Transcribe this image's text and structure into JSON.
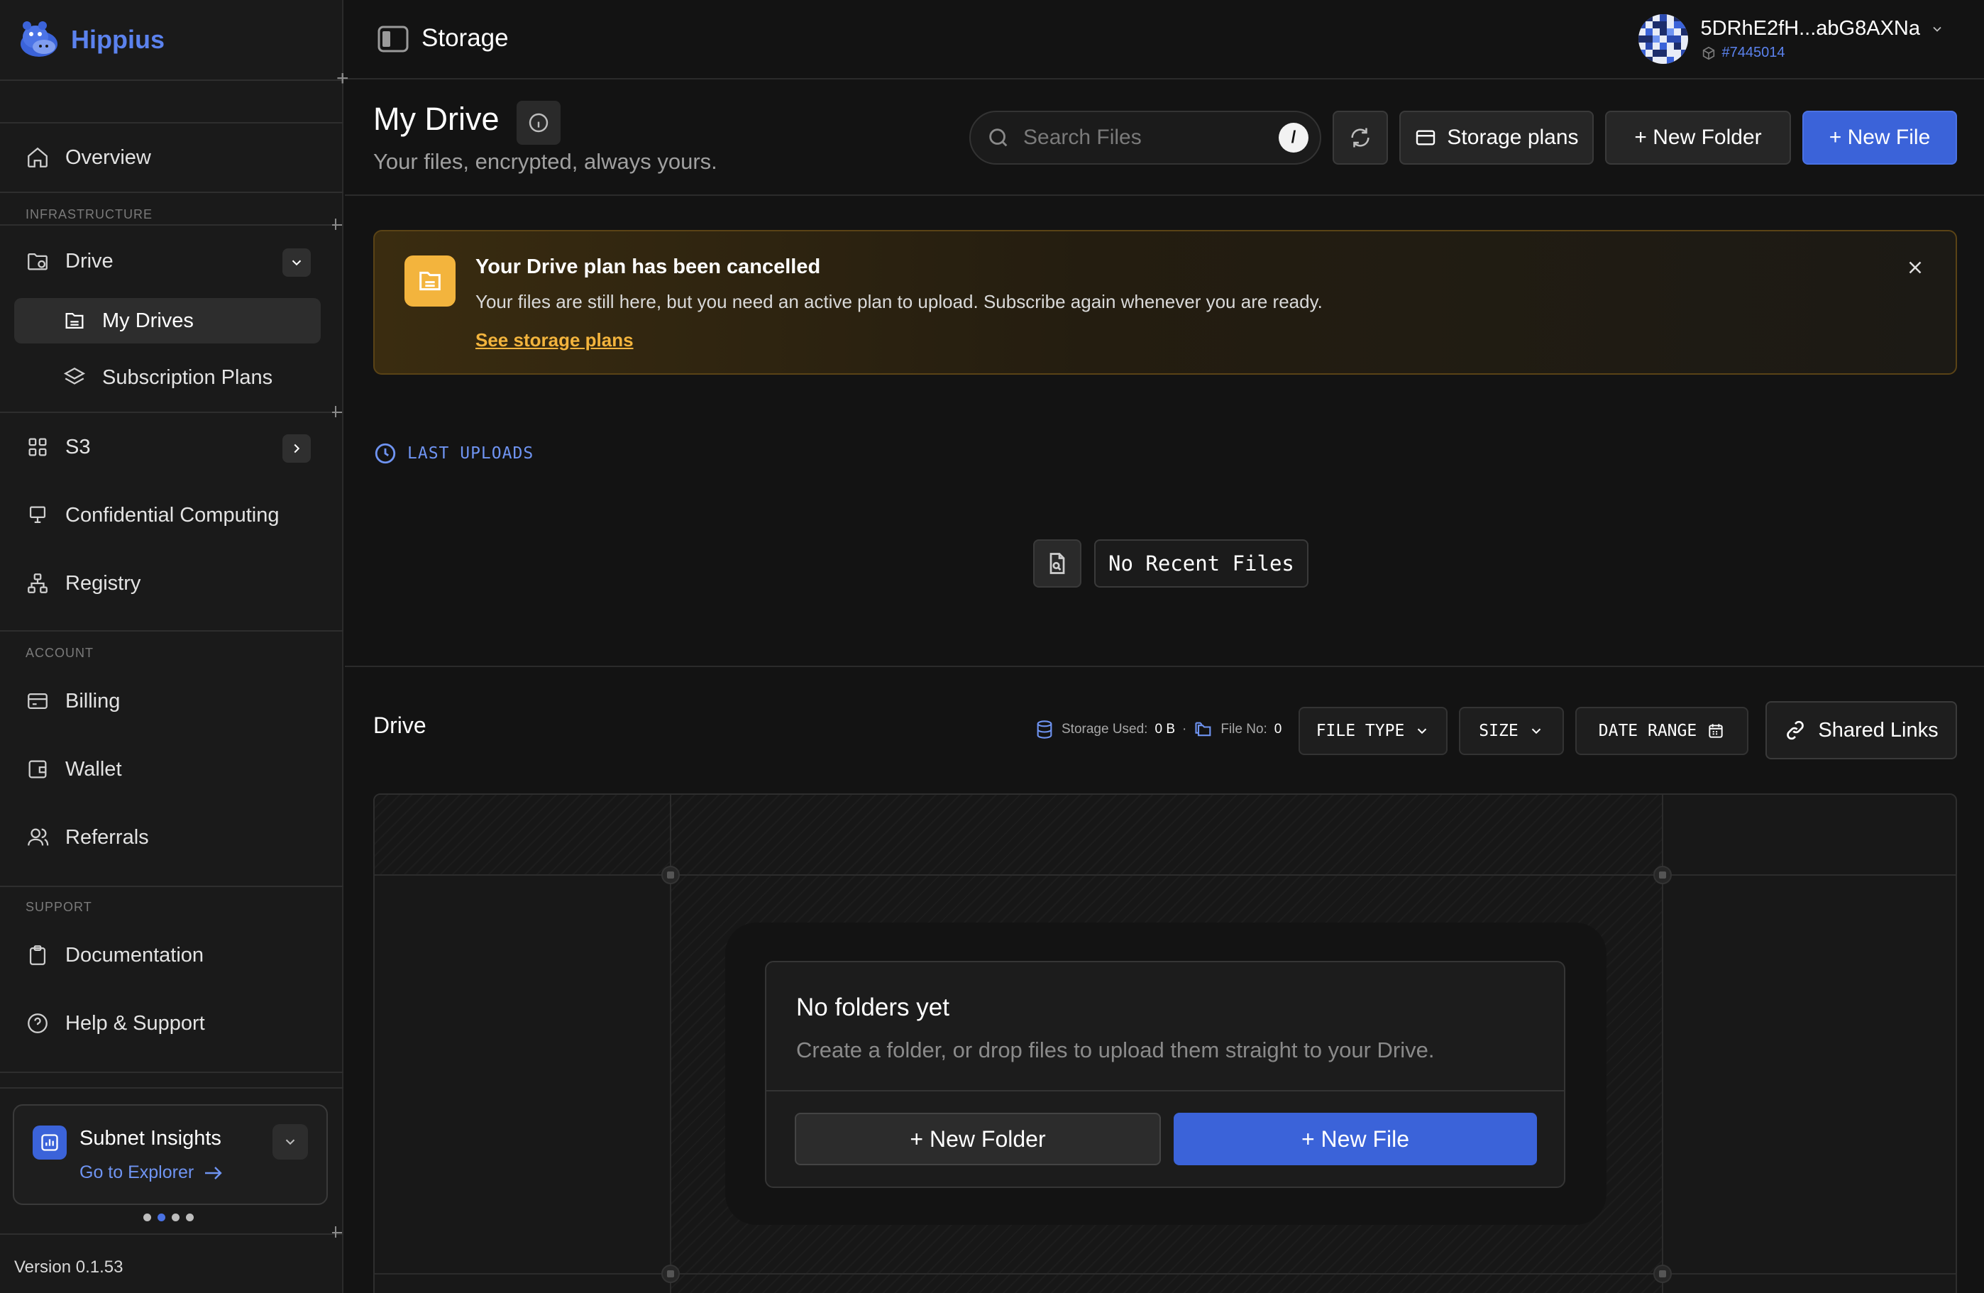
{
  "brand": {
    "name": "Hippius"
  },
  "topbar": {
    "title": "Storage"
  },
  "user": {
    "name": "5DRhE2fH...abG8AXNa",
    "id": "#7445014"
  },
  "sidebar": {
    "overview": "Overview",
    "infrastructure_label": "INFRASTRUCTURE",
    "drive": "Drive",
    "my_drives": "My Drives",
    "subscription_plans": "Subscription Plans",
    "s3": "S3",
    "confidential": "Confidential Computing",
    "registry": "Registry",
    "account_label": "ACCOUNT",
    "billing": "Billing",
    "wallet": "Wallet",
    "referrals": "Referrals",
    "support_label": "SUPPORT",
    "documentation": "Documentation",
    "help": "Help & Support",
    "insights_title": "Subnet Insights",
    "insights_link": "Go to Explorer",
    "version": "Version 0.1.53"
  },
  "header": {
    "title": "My Drive",
    "subtitle": "Your files, encrypted, always yours.",
    "search_placeholder": "Search Files",
    "search_shortcut": "/",
    "storage_plans": "Storage plans",
    "new_folder": "+ New Folder",
    "new_file": "+ New File"
  },
  "banner": {
    "title": "Your Drive plan has been cancelled",
    "message": "Your files are still here, but you need an active plan to upload. Subscribe again whenever you are ready.",
    "link": "See storage plans"
  },
  "last_uploads": {
    "label": "LAST UPLOADS",
    "empty": "No Recent Files"
  },
  "drive": {
    "title": "Drive",
    "storage_used_label": "Storage Used:",
    "storage_used_value": "0 B",
    "file_no_label": "File No:",
    "file_no_value": "0",
    "filter_type": "FILE TYPE",
    "filter_size": "SIZE",
    "filter_date": "DATE RANGE",
    "shared_links": "Shared Links",
    "empty_title": "No folders yet",
    "empty_sub": "Create a folder, or drop files to upload them straight to your Drive.",
    "empty_new_folder": "+ New Folder",
    "empty_new_file": "+ New File"
  },
  "colors": {
    "accent": "#3b63d9",
    "warning": "#f3b43d",
    "background": "#131313"
  }
}
